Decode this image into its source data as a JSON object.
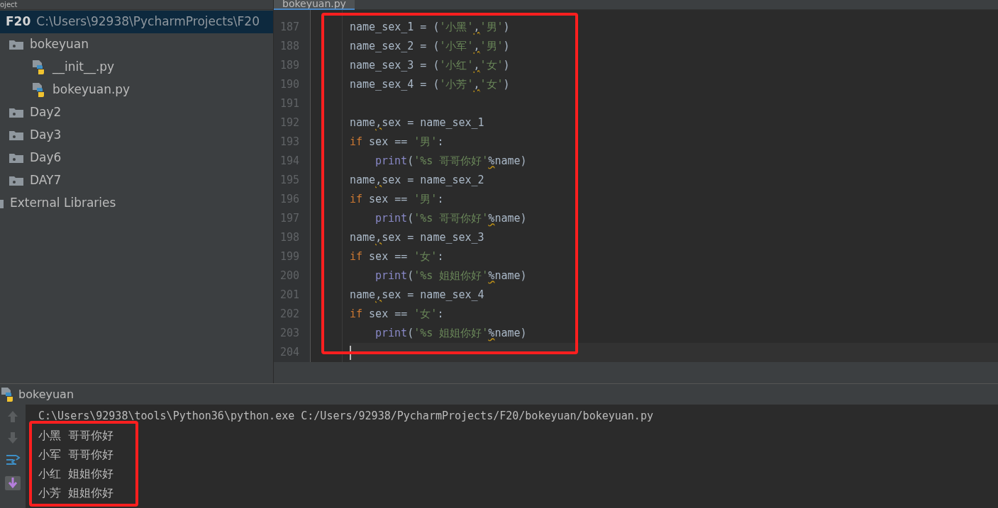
{
  "project_panel": {
    "header": "oject",
    "tree": [
      {
        "label": "F20",
        "path": "C:\\Users\\92938\\PycharmProjects\\F20",
        "kind": "root",
        "selected": true,
        "children": [
          {
            "label": "bokeyuan",
            "kind": "folder",
            "selected": false,
            "children": [
              {
                "label": "__init__.py",
                "kind": "python",
                "selected": false
              },
              {
                "label": "bokeyuan.py",
                "kind": "python",
                "selected": false
              }
            ]
          },
          {
            "label": "Day2",
            "kind": "folder",
            "selected": false
          },
          {
            "label": "Day3",
            "kind": "folder",
            "selected": false
          },
          {
            "label": "Day6",
            "kind": "folder",
            "selected": false
          },
          {
            "label": "DAY7",
            "kind": "folder",
            "selected": false
          }
        ]
      },
      {
        "label": "External Libraries",
        "kind": "library",
        "selected": false
      }
    ]
  },
  "editor": {
    "tabs": [
      {
        "label": "bokeyuan.py",
        "selected": true
      }
    ],
    "lines": [
      {
        "number": "187",
        "tokens": [
          {
            "kind": "plain",
            "text": "name_sex_1 = ("
          },
          {
            "kind": "string",
            "text": "'小黑'"
          },
          {
            "kind": "warn",
            "text": ","
          },
          {
            "kind": "string",
            "text": "'男'"
          },
          {
            "kind": "plain",
            "text": ")"
          }
        ]
      },
      {
        "number": "188",
        "tokens": [
          {
            "kind": "plain",
            "text": "name_sex_2 = ("
          },
          {
            "kind": "string",
            "text": "'小军'"
          },
          {
            "kind": "warn",
            "text": ","
          },
          {
            "kind": "string",
            "text": "'男'"
          },
          {
            "kind": "plain",
            "text": ")"
          }
        ]
      },
      {
        "number": "189",
        "tokens": [
          {
            "kind": "plain",
            "text": "name_sex_3 = ("
          },
          {
            "kind": "string",
            "text": "'小红'"
          },
          {
            "kind": "warn",
            "text": ","
          },
          {
            "kind": "string",
            "text": "'女'"
          },
          {
            "kind": "plain",
            "text": ")"
          }
        ]
      },
      {
        "number": "190",
        "tokens": [
          {
            "kind": "plain",
            "text": "name_sex_4 = ("
          },
          {
            "kind": "string",
            "text": "'小芳'"
          },
          {
            "kind": "warn",
            "text": ","
          },
          {
            "kind": "string",
            "text": "'女'"
          },
          {
            "kind": "plain",
            "text": ")"
          }
        ]
      },
      {
        "number": "191"
      },
      {
        "number": "192",
        "tokens": [
          {
            "kind": "plain",
            "text": "name"
          },
          {
            "kind": "warn",
            "text": ","
          },
          {
            "kind": "plain",
            "text": "sex = name_sex_1"
          }
        ]
      },
      {
        "number": "193",
        "tokens": [
          {
            "kind": "keyword",
            "text": "if"
          },
          {
            "kind": "plain",
            "text": " sex == "
          },
          {
            "kind": "string",
            "text": "'男'"
          },
          {
            "kind": "plain",
            "text": ":"
          }
        ]
      },
      {
        "number": "194",
        "indent": true,
        "tokens": [
          {
            "kind": "builtin",
            "text": "print"
          },
          {
            "kind": "plain",
            "text": "("
          },
          {
            "kind": "string",
            "text": "'%s 哥哥你好'"
          },
          {
            "kind": "warn",
            "text": "%"
          },
          {
            "kind": "plain",
            "text": "name)"
          }
        ]
      },
      {
        "number": "195",
        "tokens": [
          {
            "kind": "plain",
            "text": "name"
          },
          {
            "kind": "warn",
            "text": ","
          },
          {
            "kind": "plain",
            "text": "sex = name_sex_2"
          }
        ]
      },
      {
        "number": "196",
        "tokens": [
          {
            "kind": "keyword",
            "text": "if"
          },
          {
            "kind": "plain",
            "text": " sex == "
          },
          {
            "kind": "string",
            "text": "'男'"
          },
          {
            "kind": "plain",
            "text": ":"
          }
        ]
      },
      {
        "number": "197",
        "indent": true,
        "tokens": [
          {
            "kind": "builtin",
            "text": "print"
          },
          {
            "kind": "plain",
            "text": "("
          },
          {
            "kind": "string",
            "text": "'%s 哥哥你好'"
          },
          {
            "kind": "warn",
            "text": "%"
          },
          {
            "kind": "plain",
            "text": "name)"
          }
        ]
      },
      {
        "number": "198",
        "tokens": [
          {
            "kind": "plain",
            "text": "name"
          },
          {
            "kind": "warn",
            "text": ","
          },
          {
            "kind": "plain",
            "text": "sex = name_sex_3"
          }
        ]
      },
      {
        "number": "199",
        "tokens": [
          {
            "kind": "keyword",
            "text": "if"
          },
          {
            "kind": "plain",
            "text": " sex == "
          },
          {
            "kind": "string",
            "text": "'女'"
          },
          {
            "kind": "plain",
            "text": ":"
          }
        ]
      },
      {
        "number": "200",
        "indent": true,
        "tokens": [
          {
            "kind": "builtin",
            "text": "print"
          },
          {
            "kind": "plain",
            "text": "("
          },
          {
            "kind": "string",
            "text": "'%s 姐姐你好'"
          },
          {
            "kind": "warn",
            "text": "%"
          },
          {
            "kind": "plain",
            "text": "name)"
          }
        ]
      },
      {
        "number": "201",
        "tokens": [
          {
            "kind": "plain",
            "text": "name"
          },
          {
            "kind": "warn",
            "text": ","
          },
          {
            "kind": "plain",
            "text": "sex = name_sex_4"
          }
        ]
      },
      {
        "number": "202",
        "tokens": [
          {
            "kind": "keyword",
            "text": "if"
          },
          {
            "kind": "plain",
            "text": " sex == "
          },
          {
            "kind": "string",
            "text": "'女'"
          },
          {
            "kind": "plain",
            "text": ":"
          }
        ]
      },
      {
        "number": "203",
        "indent": true,
        "tokens": [
          {
            "kind": "builtin",
            "text": "print"
          },
          {
            "kind": "plain",
            "text": "("
          },
          {
            "kind": "string",
            "text": "'%s 姐姐你好'"
          },
          {
            "kind": "warn",
            "text": "%"
          },
          {
            "kind": "plain",
            "text": "name)"
          }
        ]
      },
      {
        "number": "204",
        "current": true
      }
    ]
  },
  "run_panel": {
    "title": "bokeyuan",
    "command": "C:\\Users\\92938\\tools\\Python36\\python.exe C:/Users/92938/PycharmProjects/F20/bokeyuan/bokeyuan.py",
    "output": [
      "小黑 哥哥你好",
      "小军 哥哥你好",
      "小红 姐姐你好",
      "小芳 姐姐你好"
    ]
  }
}
